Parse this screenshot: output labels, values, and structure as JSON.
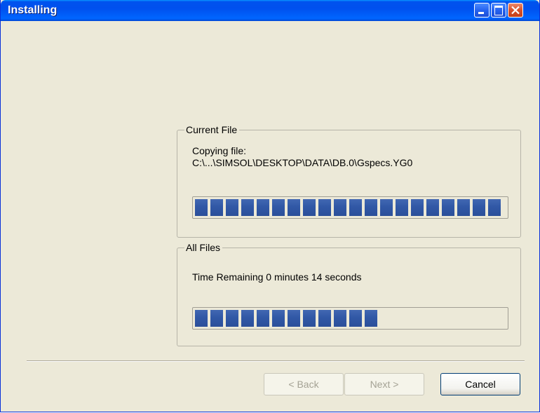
{
  "window": {
    "title": "Installing"
  },
  "current_file": {
    "group_label": "Current File",
    "status_text": "Copying file:",
    "file_path": "C:\\...\\SIMSOL\\DESKTOP\\DATA\\DB.0\\Gspecs.YG0",
    "progress": 1.0
  },
  "all_files": {
    "group_label": "All Files",
    "time_remaining": "Time Remaining 0 minutes 14 seconds",
    "progress": 0.6
  },
  "buttons": {
    "back_label": "< Back",
    "next_label": "Next >",
    "cancel_label": "Cancel"
  },
  "colors": {
    "title_bar": "#0053ee",
    "progress_block": "#3158a6",
    "dialog_background": "#ece9d8",
    "close_button": "#d9512a"
  }
}
